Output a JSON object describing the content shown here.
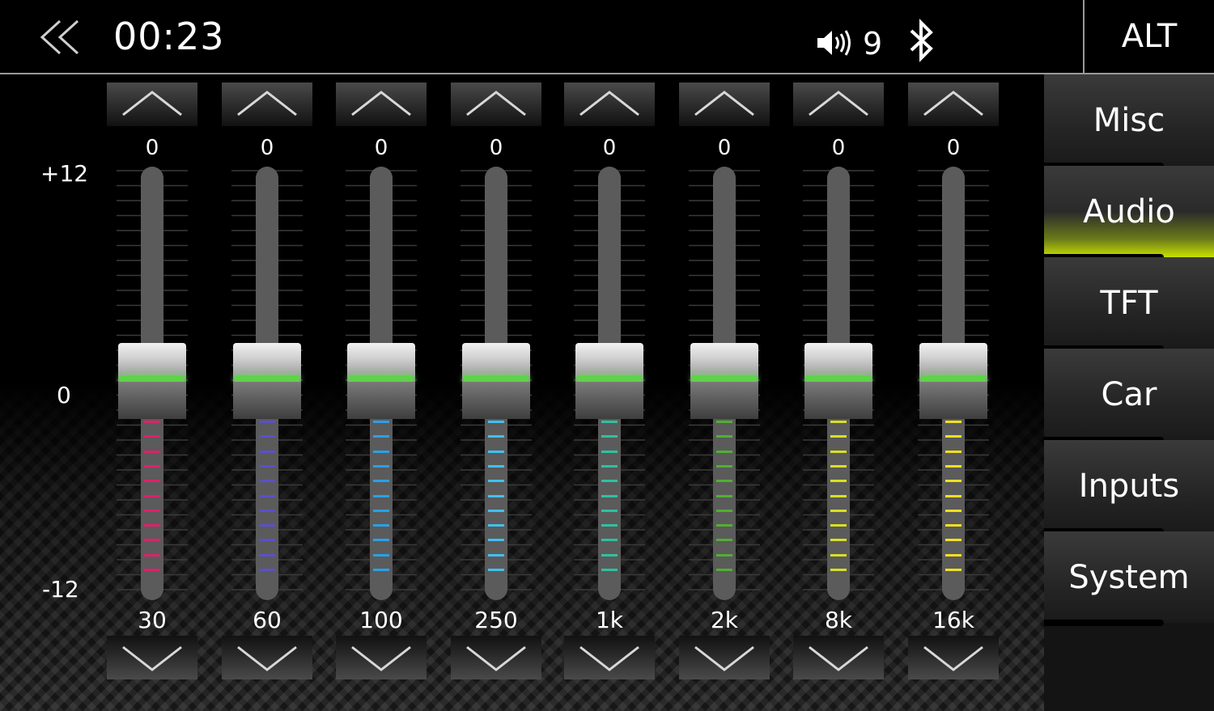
{
  "header": {
    "time": "00:23",
    "volume": "9",
    "alt_label": "ALT"
  },
  "scale": {
    "top": "+12",
    "middle": "0",
    "bottom": "-12"
  },
  "bands": [
    {
      "freq": "30",
      "value": "0",
      "color": "#e0206a"
    },
    {
      "freq": "60",
      "value": "0",
      "color": "#5a50c8"
    },
    {
      "freq": "100",
      "value": "0",
      "color": "#2aa0e8"
    },
    {
      "freq": "250",
      "value": "0",
      "color": "#40c0f0"
    },
    {
      "freq": "1k",
      "value": "0",
      "color": "#30c0a0"
    },
    {
      "freq": "2k",
      "value": "0",
      "color": "#50b030"
    },
    {
      "freq": "8k",
      "value": "0",
      "color": "#d8e020"
    },
    {
      "freq": "16k",
      "value": "0",
      "color": "#f0e020"
    }
  ],
  "menu": [
    "Misc",
    "Audio",
    "TFT",
    "Car",
    "Inputs",
    "System"
  ],
  "active_menu": "Audio",
  "colors": {
    "accent": "#c8e000",
    "knob_glow": "#5fd24a"
  }
}
